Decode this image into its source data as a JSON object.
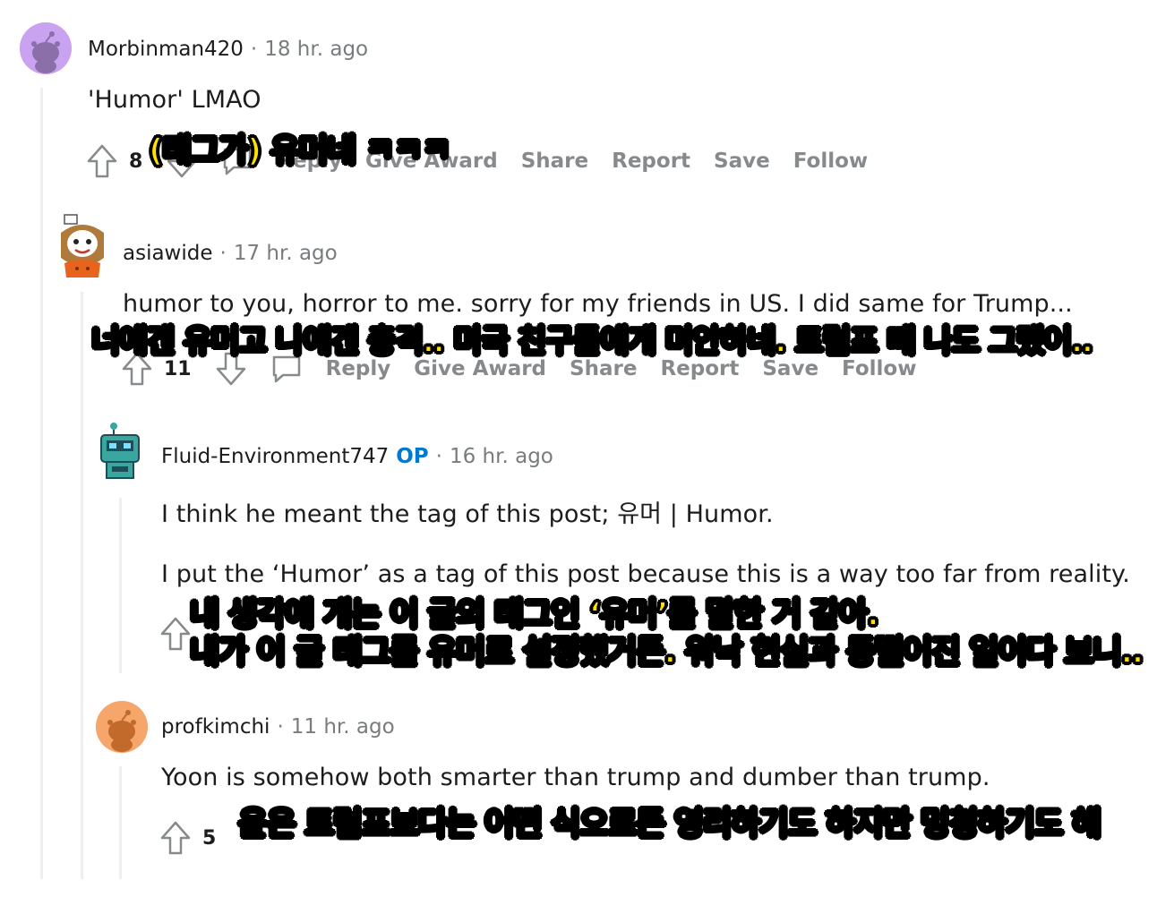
{
  "comments": [
    {
      "author": "Morbinman420",
      "time": "18 hr. ago",
      "body": "'Humor' LMAO",
      "votes": "8",
      "actions": [
        "Reply",
        "Give Award",
        "Share",
        "Report",
        "Save",
        "Follow"
      ],
      "subtitle": "(태그가) 유머네 ㅋㅋㅋ",
      "avatar_color": "#c9a3f0"
    },
    {
      "author": "asiawide",
      "time": "17 hr. ago",
      "body": "humor to you, horror to me. sorry for my friends in US. I did same for Trump...",
      "votes": "11",
      "actions": [
        "Reply",
        "Give Award",
        "Share",
        "Report",
        "Save",
        "Follow"
      ],
      "subtitle": "너에겐 유머고 나에겐 충격.. 미국 친구들에게 미안하네. 트럼프 때 나도 그랬어.."
    },
    {
      "author": "Fluid-Environment747",
      "op_badge": "OP",
      "time": "16 hr. ago",
      "body_lines": [
        "I think he meant the tag of this post; 유머 | Humor.",
        "I put the ‘Humor’ as a tag of this post because this is a way too far from reality."
      ],
      "subtitle_lines": [
        "내 생각에 걔는 이 글의 태그인 ‘유머’를 말한 거 같아.",
        "내가 이 글 태그를 유머로 설정했거든. 워낙 현실과 동떨어진 일이다 보니.."
      ]
    },
    {
      "author": "profkimchi",
      "time": "11 hr. ago",
      "body": "Yoon is somehow both smarter than trump and dumber than trump.",
      "votes": "5",
      "subtitle": "윤은 트럼프보다는 어떤 식으로든 영리하기도 하지만 멍청하기도 해",
      "avatar_color": "#f6a56b"
    }
  ],
  "colors": {
    "accent_op": "#0079d3",
    "subtitle_fill": "#ffe000",
    "thread_line": "#edeff1",
    "meta": "#787c7e"
  }
}
